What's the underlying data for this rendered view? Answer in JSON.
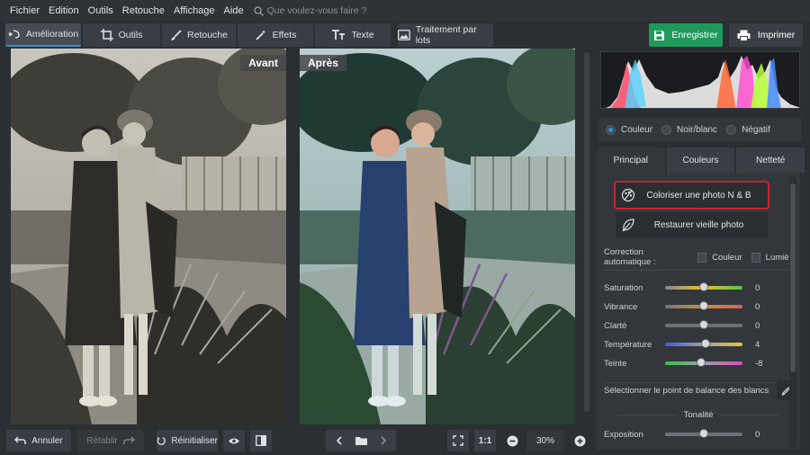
{
  "menu": {
    "items": [
      "Fichier",
      "Edition",
      "Outils",
      "Retouche",
      "Affichage",
      "Aide"
    ],
    "search_placeholder": "Que voulez-vous faire ?"
  },
  "toolbar": {
    "tabs": [
      {
        "label": "Amélioration",
        "icon": "enhance-icon",
        "active": true
      },
      {
        "label": "Outils",
        "icon": "crop-icon",
        "active": false
      },
      {
        "label": "Retouche",
        "icon": "brush-icon",
        "active": false
      },
      {
        "label": "Effets",
        "icon": "magic-wand-icon",
        "active": false
      },
      {
        "label": "Texte",
        "icon": "text-icon",
        "active": false
      }
    ],
    "batch_label": "Traitement par lots",
    "save_label": "Enregistrer",
    "print_label": "Imprimer",
    "accent": "#1f9a5a"
  },
  "workspace": {
    "before_label": "Avant",
    "after_label": "Après"
  },
  "bottom": {
    "undo_label": "Annuler",
    "redo_label": "Rétablir",
    "reset_label": "Réinitialiser",
    "ratio_label": "1:1",
    "zoom_value": "30%"
  },
  "panel": {
    "color_modes": [
      {
        "label": "Couleur",
        "selected": true
      },
      {
        "label": "Noir/blanc",
        "selected": false
      },
      {
        "label": "Négatif",
        "selected": false
      }
    ],
    "tabs": [
      "Principal",
      "Couleurs",
      "Netteté"
    ],
    "active_tab": "Principal",
    "colorize_label": "Coloriser une photo N & B",
    "restore_label": "Restaurer vieille photo",
    "auto_label": "Correction automatique :",
    "auto_color_label": "Couleur",
    "auto_light_label": "Lumière",
    "sliders": [
      {
        "name": "Saturation",
        "value": "0",
        "pos": 0.5
      },
      {
        "name": "Vibrance",
        "value": "0",
        "pos": 0.5
      },
      {
        "name": "Clarté",
        "value": "0",
        "pos": 0.5
      },
      {
        "name": "Température",
        "value": "4",
        "pos": 0.52
      },
      {
        "name": "Teinte",
        "value": "-8",
        "pos": 0.46
      }
    ],
    "white_balance_label": "Sélectionner le point de balance des blancs",
    "tonality_label": "Tonalité",
    "exposure": {
      "name": "Exposition",
      "value": "0",
      "pos": 0.5
    },
    "highlight_color": "#c8232c"
  }
}
